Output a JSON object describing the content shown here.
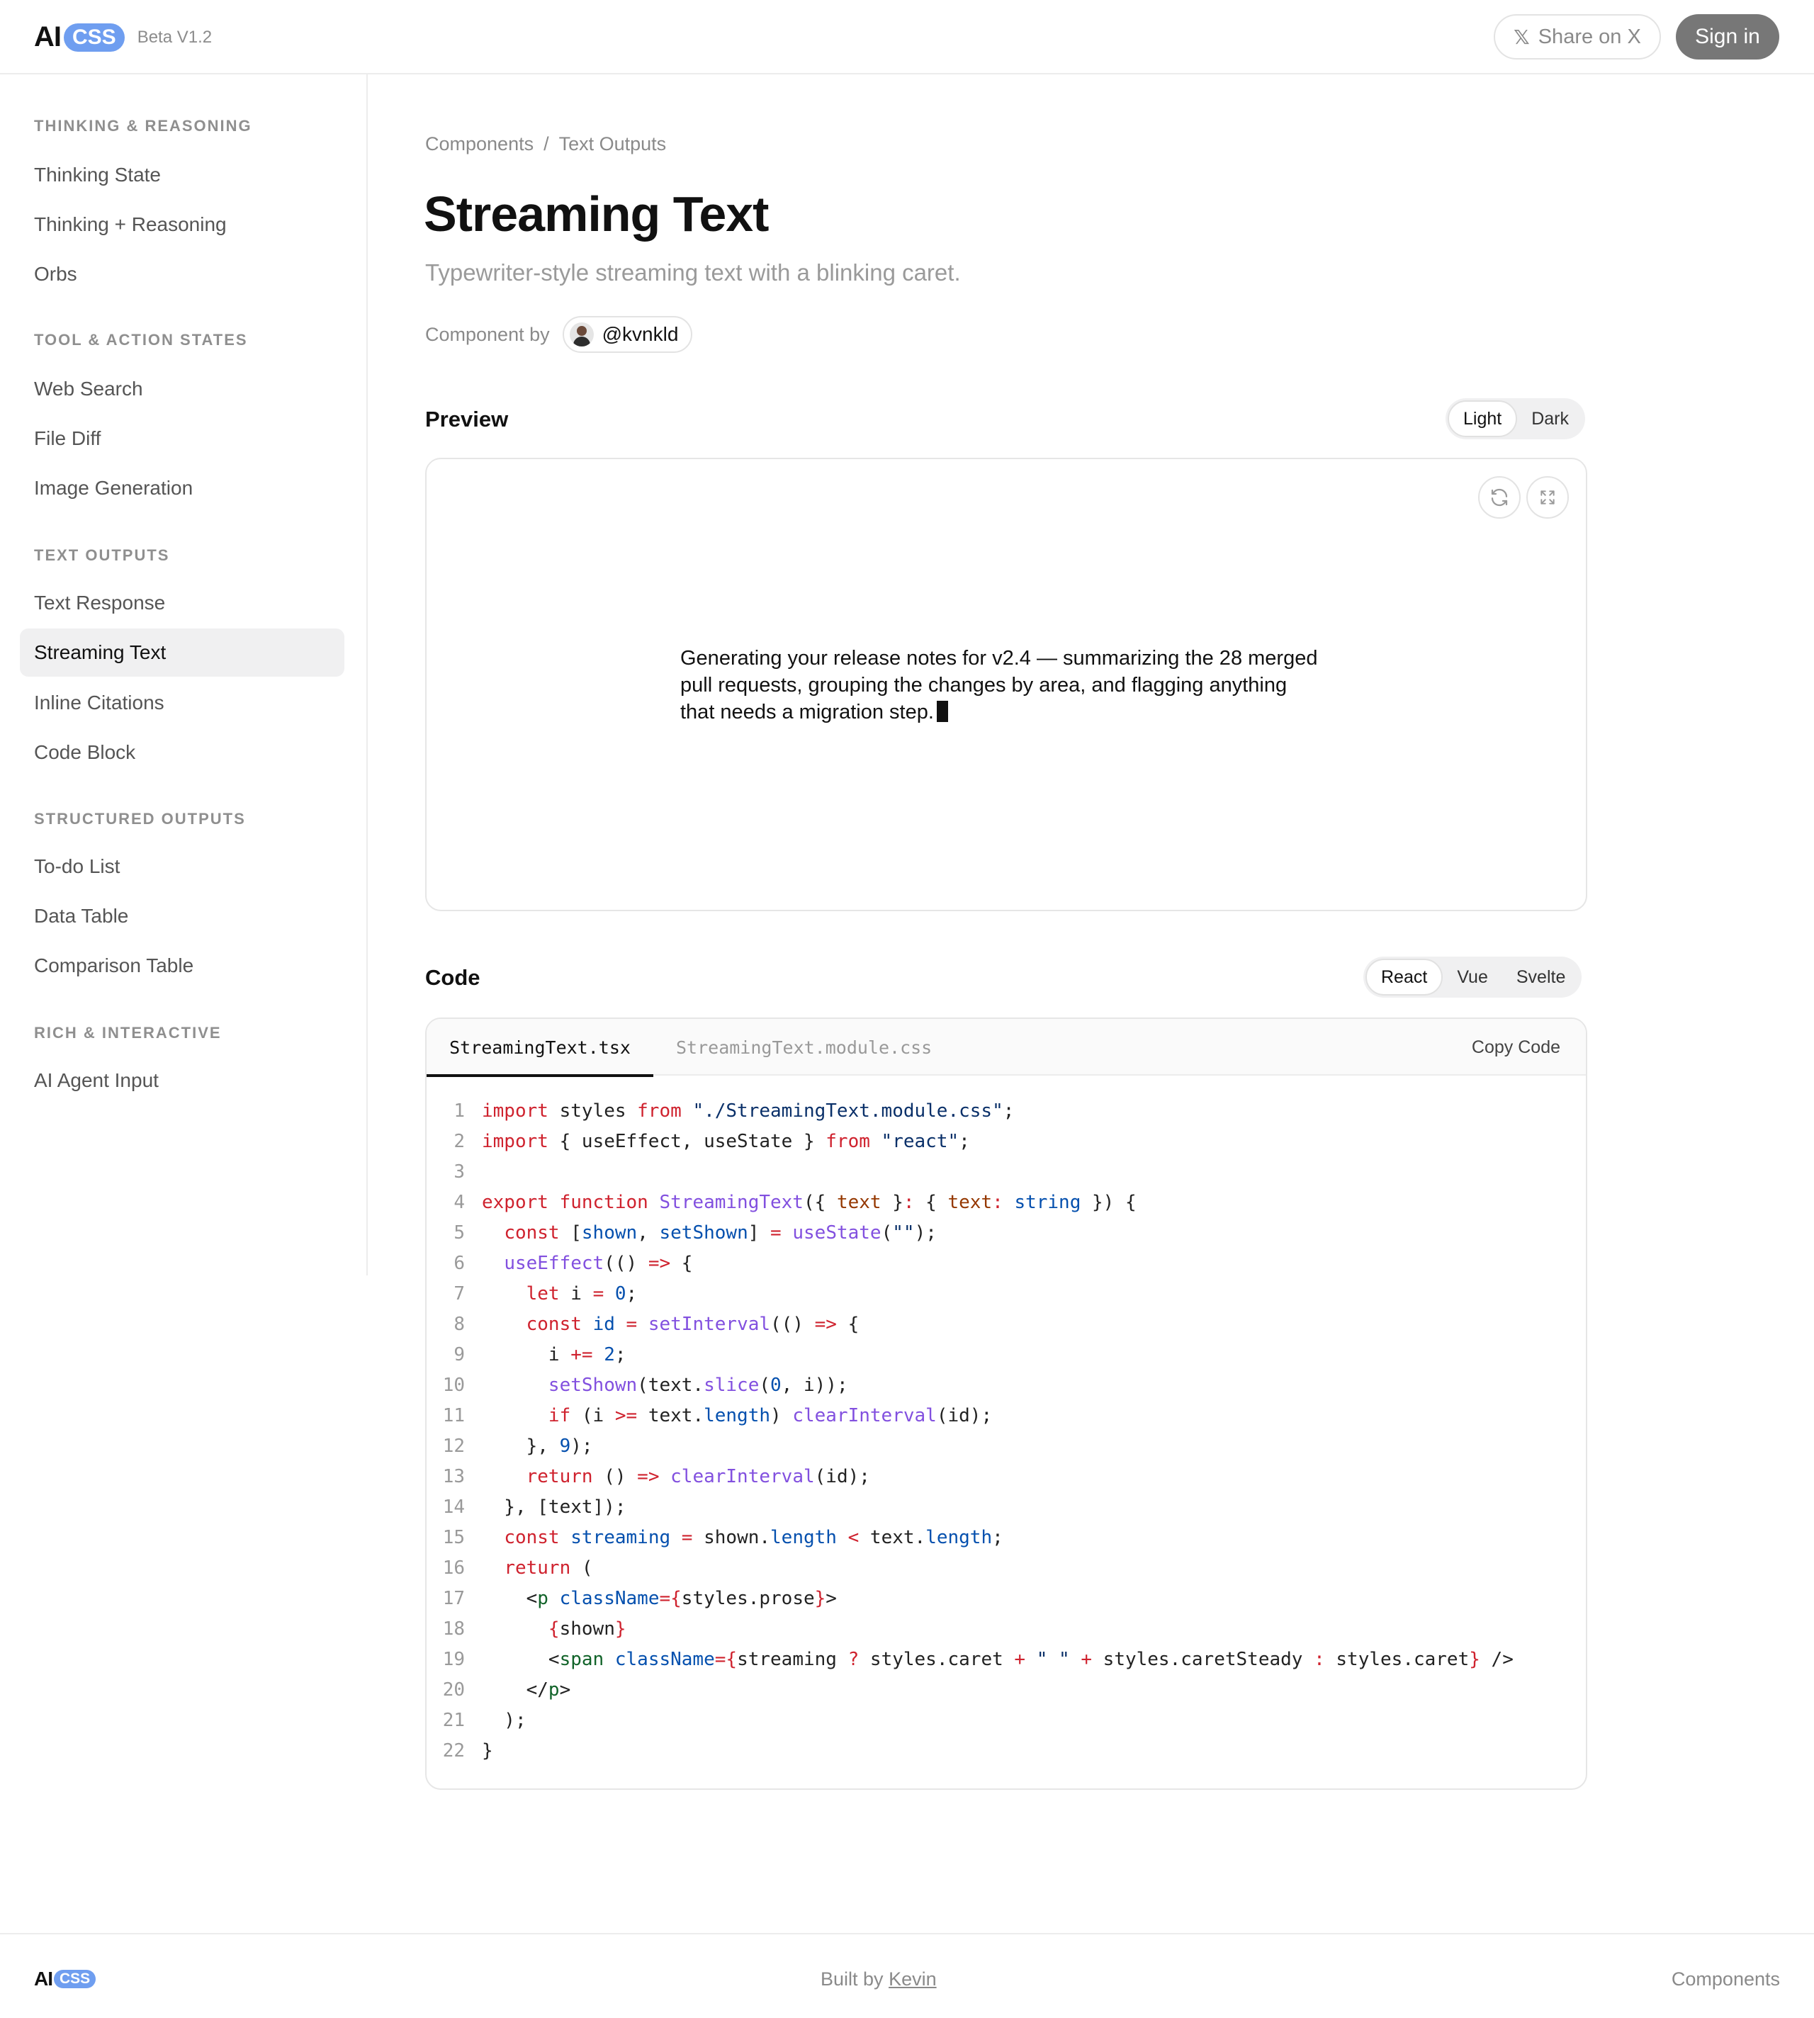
{
  "header": {
    "logo_ai": "AI",
    "logo_css": "CSS",
    "version": "Beta V1.2",
    "share_label": "Share on X",
    "signin_label": "Sign in"
  },
  "sidebar": {
    "sections": [
      {
        "title": "THINKING & REASONING",
        "items": [
          "Thinking State",
          "Thinking + Reasoning",
          "Orbs"
        ]
      },
      {
        "title": "TOOL & ACTION STATES",
        "items": [
          "Web Search",
          "File Diff",
          "Image Generation"
        ]
      },
      {
        "title": "TEXT OUTPUTS",
        "items": [
          "Text Response",
          "Streaming Text",
          "Inline Citations",
          "Code Block"
        ]
      },
      {
        "title": "STRUCTURED OUTPUTS",
        "items": [
          "To-do List",
          "Data Table",
          "Comparison Table"
        ]
      },
      {
        "title": "RICH & INTERACTIVE",
        "items": [
          "AI Agent Input"
        ]
      }
    ],
    "active_item": "Streaming Text"
  },
  "main": {
    "breadcrumb": [
      "Components",
      "Text Outputs"
    ],
    "breadcrumb_sep": "/",
    "title": "Streaming Text",
    "subtitle": "Typewriter-style streaming text with a blinking caret.",
    "author_label": "Component by",
    "author_handle": "@kvnkld",
    "preview": {
      "heading": "Preview",
      "theme_options": [
        "Light",
        "Dark"
      ],
      "theme_selected": "Light",
      "text": "Generating your release notes for v2.4 — summarizing the 28 merged pull requests, grouping the changes by area, and flagging anything that needs a migration step."
    },
    "code": {
      "heading": "Code",
      "framework_options": [
        "React",
        "Vue",
        "Svelte"
      ],
      "framework_selected": "React",
      "tabs": [
        "StreamingText.tsx",
        "StreamingText.module.css"
      ],
      "active_tab": "StreamingText.tsx",
      "copy_label": "Copy Code",
      "line_numbers": [
        "1",
        "2",
        "3",
        "4",
        "5",
        "6",
        "7",
        "8",
        "9",
        "10",
        "11",
        "12",
        "13",
        "14",
        "15",
        "16",
        "17",
        "18",
        "19",
        "20",
        "21",
        "22"
      ]
    }
  },
  "footer": {
    "logo_ai": "AI",
    "logo_css": "CSS",
    "built_prefix": "Built by",
    "built_link": "Kevin",
    "components_label": "Components"
  },
  "icons": {
    "share": "x-logo-icon",
    "refresh": "refresh-icon",
    "fullscreen": "expand-icon"
  }
}
